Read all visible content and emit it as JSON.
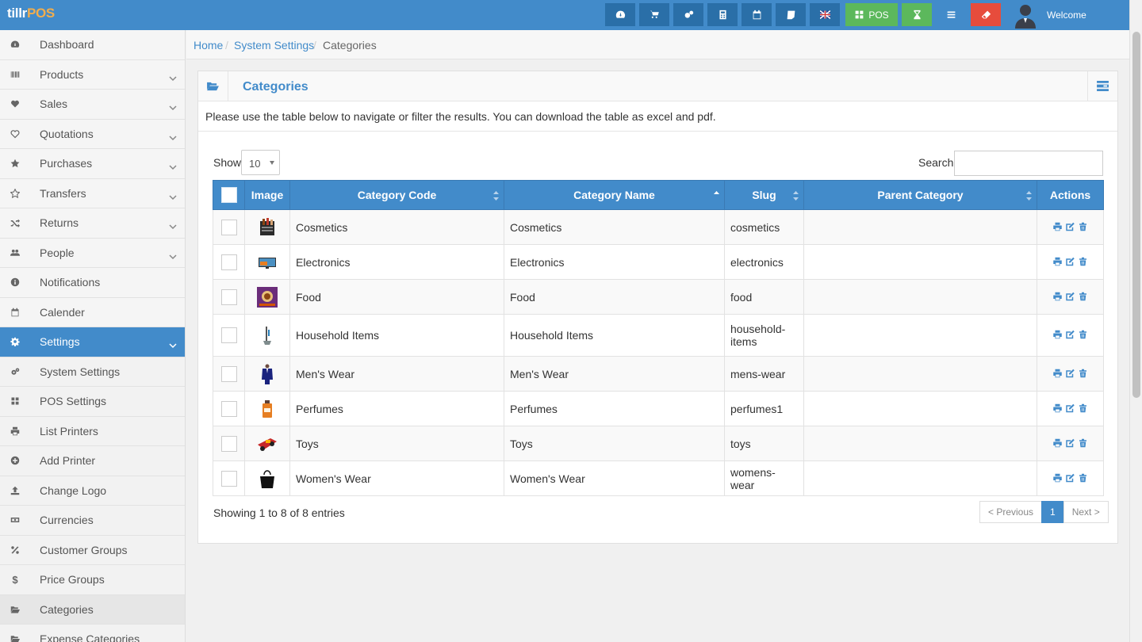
{
  "app": {
    "brand_a": "tillr",
    "brand_b": "POS",
    "welcome": "Welcome",
    "pos_label": "POS"
  },
  "topbar_icons": [
    "dashboard-icon",
    "cart-icon",
    "settings-icon",
    "calculator-icon",
    "calendar-icon",
    "sticky-note-icon",
    "language-flag-icon",
    "pos-icon",
    "hourglass-icon",
    "list-icon",
    "eraser-icon"
  ],
  "sidebar": {
    "items": [
      {
        "label": "Dashboard",
        "icon": "dashboard-icon"
      },
      {
        "label": "Products",
        "icon": "barcode-icon"
      },
      {
        "label": "Sales",
        "icon": "heart-icon"
      },
      {
        "label": "Quotations",
        "icon": "heart-outline-icon"
      },
      {
        "label": "Purchases",
        "icon": "star-icon"
      },
      {
        "label": "Transfers",
        "icon": "star-outline-icon"
      },
      {
        "label": "Returns",
        "icon": "random-icon"
      },
      {
        "label": "People",
        "icon": "users-icon"
      },
      {
        "label": "Notifications",
        "icon": "info-icon"
      },
      {
        "label": "Calender",
        "icon": "calendar-icon"
      },
      {
        "label": "Settings",
        "icon": "cog-icon"
      },
      {
        "label": "System Settings",
        "icon": "cogs-icon"
      },
      {
        "label": "POS Settings",
        "icon": "th-large-icon"
      },
      {
        "label": "List Printers",
        "icon": "printer-icon"
      },
      {
        "label": "Add Printer",
        "icon": "plus-circle-icon"
      },
      {
        "label": "Change Logo",
        "icon": "upload-icon"
      },
      {
        "label": "Currencies",
        "icon": "money-icon"
      },
      {
        "label": "Customer Groups",
        "icon": "percent-icon"
      },
      {
        "label": "Price Groups",
        "icon": "dollar-icon"
      },
      {
        "label": "Categories",
        "icon": "folder-open-icon"
      },
      {
        "label": "Expense Categories",
        "icon": "folder-open-icon"
      }
    ]
  },
  "breadcrumb": {
    "home": "Home",
    "parent": "System Settings",
    "current": "Categories",
    "sep": "/"
  },
  "panel": {
    "title": "Categories",
    "info": "Please use the table below to navigate or filter the results. You can download the table as excel and pdf."
  },
  "controls": {
    "show_label": "Show",
    "show_value": "10",
    "search_label": "Search",
    "search_value": ""
  },
  "table": {
    "headers": [
      "Image",
      "Category Code",
      "Category Name",
      "Slug",
      "Parent Category",
      "Actions"
    ],
    "rows": [
      {
        "code": "Cosmetics",
        "name": "Cosmetics",
        "slug": "cosmetics",
        "parent": "",
        "image": "cosmetics-image"
      },
      {
        "code": "Electronics",
        "name": "Electronics",
        "slug": "electronics",
        "parent": "",
        "image": "electronics-image"
      },
      {
        "code": "Food",
        "name": "Food",
        "slug": "food",
        "parent": "",
        "image": "food-image"
      },
      {
        "code": "Household Items",
        "name": "Household Items",
        "slug": "household-items",
        "parent": "",
        "image": "household-items-image"
      },
      {
        "code": "Men's Wear",
        "name": "Men's Wear",
        "slug": "mens-wear",
        "parent": "",
        "image": "mens-wear-image"
      },
      {
        "code": "Perfumes",
        "name": "Perfumes",
        "slug": "perfumes1",
        "parent": "",
        "image": "perfumes-image"
      },
      {
        "code": "Toys",
        "name": "Toys",
        "slug": "toys",
        "parent": "",
        "image": "toys-image"
      },
      {
        "code": "Women's Wear",
        "name": "Women's Wear",
        "slug": "womens-wear",
        "parent": "",
        "image": "womens-wear-image"
      }
    ]
  },
  "footer": {
    "showing": "Showing 1 to 8 of 8 entries",
    "prev": "< Previous",
    "page": "1",
    "next": "Next >"
  },
  "colors": {
    "primary": "#428bca",
    "green": "#5cb85c",
    "red": "#e74c3c",
    "brand_accent": "#f0ad4e"
  }
}
